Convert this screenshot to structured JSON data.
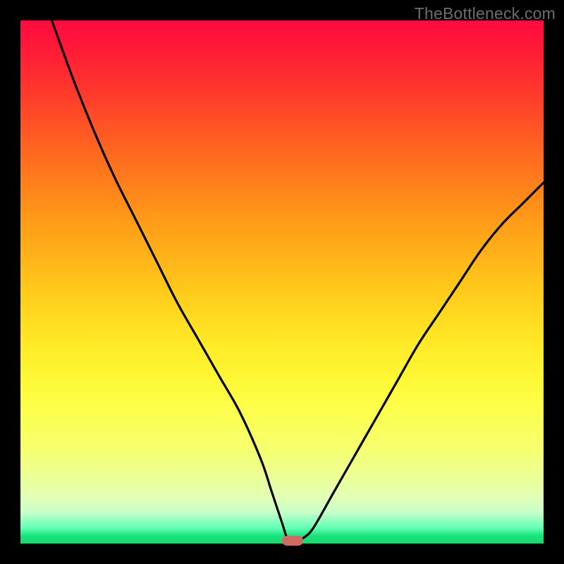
{
  "attribution": "TheBottleneck.com",
  "colors": {
    "frame": "#000000",
    "gradient_top": "#ff0b3f",
    "gradient_bottom": "#19d86e",
    "curve": "#000000",
    "marker": "#cf6a60",
    "attribution_text": "#6d6d6d"
  },
  "chart_data": {
    "type": "line",
    "title": "",
    "xlabel": "",
    "ylabel": "",
    "xlim": [
      0,
      100
    ],
    "ylim": [
      0,
      100
    ],
    "grid": false,
    "legend": false,
    "series": [
      {
        "name": "bottleneck-curve",
        "x": [
          6,
          10,
          14,
          18,
          22,
          26,
          30,
          34,
          38,
          42,
          46,
          48,
          50,
          51,
          52,
          53,
          54,
          56,
          60,
          64,
          68,
          72,
          76,
          80,
          84,
          88,
          92,
          96,
          100
        ],
        "y": [
          100,
          89,
          79,
          70,
          62,
          54,
          46,
          39,
          32,
          25,
          16,
          10,
          4,
          1,
          0.5,
          0.5,
          1,
          3,
          10,
          17,
          24,
          31,
          38,
          44,
          50,
          56,
          61,
          65,
          69
        ]
      }
    ],
    "annotations": [
      {
        "name": "optimal-marker",
        "x": 52,
        "y": 0.5
      }
    ]
  }
}
